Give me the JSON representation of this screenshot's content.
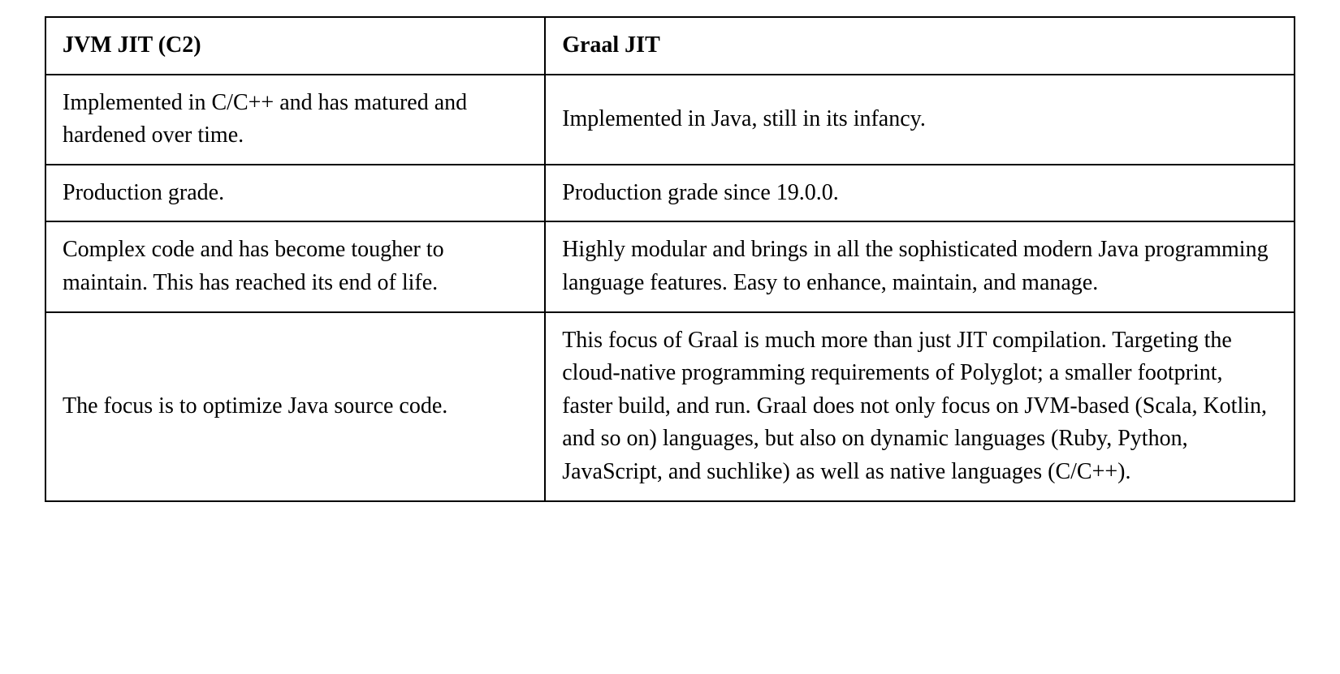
{
  "table": {
    "headers": {
      "col1": "JVM JIT (C2)",
      "col2": "Graal JIT"
    },
    "rows": [
      {
        "col1": "Implemented in C/C++ and has matured and hardened over time.",
        "col2": "Implemented in Java, still in its infancy."
      },
      {
        "col1": "Production grade.",
        "col2": "Production grade since 19.0.0."
      },
      {
        "col1": "Complex code and has become tougher to maintain. This has reached its end of life.",
        "col2": "Highly modular and brings in all the sophisticated modern Java programming language features. Easy to enhance, maintain, and manage."
      },
      {
        "col1": "The focus is to optimize Java source code.",
        "col2": "This focus of Graal is much more than just JIT compilation. Targeting the cloud-native programming requirements of Polyglot; a smaller footprint, faster build, and run. Graal does not only focus on JVM-based (Scala, Kotlin, and so on) languages, but also on dynamic languages (Ruby, Python, JavaScript, and suchlike) as well as native languages (C/C++)."
      }
    ]
  }
}
